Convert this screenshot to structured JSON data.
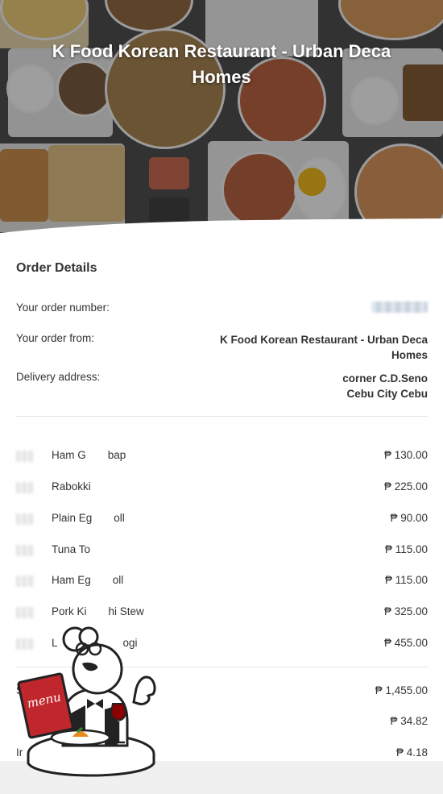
{
  "restaurant": {
    "title": "K Food Korean Restaurant - Urban Deca Homes"
  },
  "order": {
    "section_title": "Order Details",
    "number_label": "Your order number:",
    "from_label": "Your order from:",
    "from_value_line1": "K Food Korean Restaurant - Urban Deca",
    "from_value_line2": "Homes",
    "address_label": "Delivery address:",
    "address_line1": "corner C.D.Seno",
    "address_line2": "Cebu City Cebu"
  },
  "items": [
    {
      "name": "Ham G  bap",
      "price": "₱ 130.00"
    },
    {
      "name": "Rabokki",
      "price": "₱ 225.00"
    },
    {
      "name": "Plain Eg  oll",
      "price": "₱ 90.00"
    },
    {
      "name": "Tuna To",
      "price": "₱ 115.00"
    },
    {
      "name": "Ham Eg  oll",
      "price": "₱ 115.00"
    },
    {
      "name": "Pork Ki  hi Stew",
      "price": "₱ 325.00"
    },
    {
      "name": "L      ogi",
      "price": "₱ 455.00"
    }
  ],
  "summary": {
    "subtotal_label": "S",
    "subtotal_value": "₱ 1,455.00",
    "fee_label": "",
    "fee_value": "₱ 34.82",
    "tax_label": "Ir",
    "tax_value": "₱ 4.18"
  },
  "badge": {
    "menu_text": "menu"
  },
  "colors": {
    "text": "#333333",
    "divider": "#e6e6e6",
    "badge_red": "#c0272d"
  }
}
